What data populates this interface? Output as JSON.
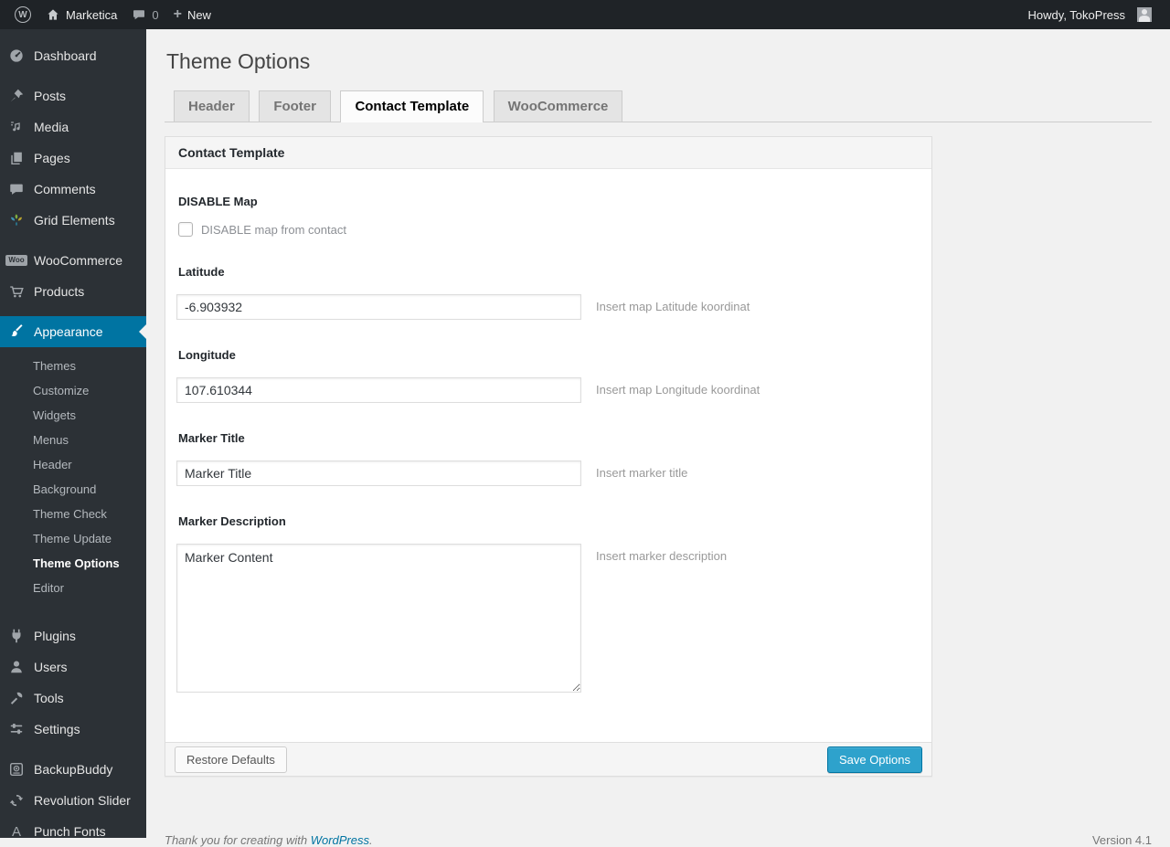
{
  "admin_bar": {
    "site_name": "Marketica",
    "comment_count": "0",
    "plus": "+",
    "new_label": "New",
    "howdy_label": "Howdy, TokoPress"
  },
  "sidebar": {
    "groups": [
      {
        "items": [
          {
            "label": "Dashboard",
            "icon": "gauge-icon"
          }
        ]
      },
      {
        "items": [
          {
            "label": "Posts",
            "icon": "pushpin-icon"
          },
          {
            "label": "Media",
            "icon": "media-icon"
          },
          {
            "label": "Pages",
            "icon": "pages-icon"
          },
          {
            "label": "Comments",
            "icon": "comment-bubble-icon"
          },
          {
            "label": "Grid Elements",
            "icon": "grid-elements-icon"
          }
        ]
      },
      {
        "items": [
          {
            "label": "WooCommerce",
            "icon": "woo-badge-icon"
          },
          {
            "label": "Products",
            "icon": "cart-icon"
          }
        ]
      },
      {
        "items": [
          {
            "label": "Appearance",
            "icon": "brush-icon",
            "active": true
          }
        ]
      },
      {
        "items": [
          {
            "label": "Plugins",
            "icon": "plug-icon"
          },
          {
            "label": "Users",
            "icon": "user-icon"
          },
          {
            "label": "Tools",
            "icon": "wrench-icon"
          },
          {
            "label": "Settings",
            "icon": "sliders-icon"
          }
        ]
      },
      {
        "items": [
          {
            "label": "BackupBuddy",
            "icon": "backup-disk-icon"
          },
          {
            "label": "Revolution Slider",
            "icon": "refresh-arrows-icon"
          },
          {
            "label": "Punch Fonts",
            "icon": "letter-a-icon"
          }
        ]
      }
    ],
    "appearance_submenu": [
      {
        "label": "Themes"
      },
      {
        "label": "Customize"
      },
      {
        "label": "Widgets"
      },
      {
        "label": "Menus"
      },
      {
        "label": "Header"
      },
      {
        "label": "Background"
      },
      {
        "label": "Theme Check"
      },
      {
        "label": "Theme Update"
      },
      {
        "label": "Theme Options",
        "current": true
      },
      {
        "label": "Editor"
      }
    ]
  },
  "page": {
    "title": "Theme Options",
    "tabs": [
      {
        "label": "Header"
      },
      {
        "label": "Footer"
      },
      {
        "label": "Contact Template",
        "active": true
      },
      {
        "label": "WooCommerce"
      }
    ]
  },
  "panel": {
    "title": "Contact Template",
    "disable_map": {
      "label": "DISABLE Map",
      "checkbox_label": "DISABLE map from contact",
      "checked": false
    },
    "latitude": {
      "label": "Latitude",
      "value": "-6.903932",
      "hint": "Insert map Latitude koordinat"
    },
    "longitude": {
      "label": "Longitude",
      "value": "107.610344",
      "hint": "Insert map Longitude koordinat"
    },
    "marker_title": {
      "label": "Marker Title",
      "value": "Marker Title",
      "hint": "Insert marker title"
    },
    "marker_description": {
      "label": "Marker Description",
      "value": "Marker Content",
      "hint": "Insert marker description"
    },
    "restore_button": "Restore Defaults",
    "save_button": "Save Options"
  },
  "footer": {
    "thanks_prefix": "Thank you for creating with ",
    "thanks_link": "WordPress",
    "thanks_suffix": ".",
    "version": "Version 4.1"
  },
  "colors": {
    "highlight": "#0074a2",
    "primary_button": "#2ea2cc",
    "admin_bar_bg": "#1f2327",
    "sidebar_bg": "#2c3136",
    "content_bg": "#f1f1f1"
  }
}
